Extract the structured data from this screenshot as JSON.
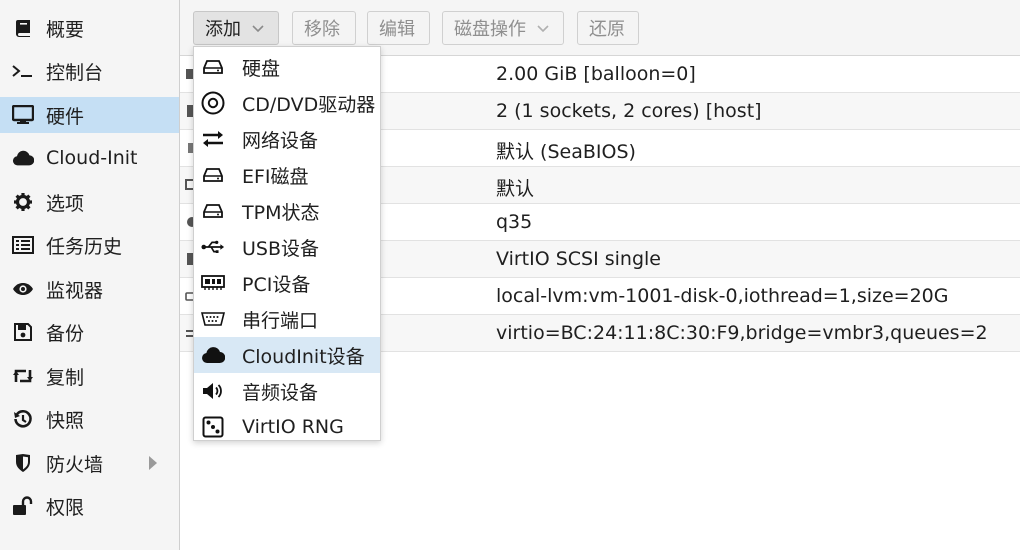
{
  "sidebar": {
    "items": [
      {
        "label": "概要",
        "icon": "book-icon",
        "active": false
      },
      {
        "label": "控制台",
        "icon": "terminal-icon",
        "active": false
      },
      {
        "label": "硬件",
        "icon": "monitor-icon",
        "active": true
      },
      {
        "label": "Cloud-Init",
        "icon": "cloud-icon",
        "active": false
      },
      {
        "label": "选项",
        "icon": "gear-icon",
        "active": false
      },
      {
        "label": "任务历史",
        "icon": "list-icon",
        "active": false
      },
      {
        "label": "监视器",
        "icon": "eye-icon",
        "active": false
      },
      {
        "label": "备份",
        "icon": "floppy-icon",
        "active": false
      },
      {
        "label": "复制",
        "icon": "retweet-icon",
        "active": false
      },
      {
        "label": "快照",
        "icon": "history-icon",
        "active": false
      },
      {
        "label": "防火墙",
        "icon": "shield-icon",
        "active": false,
        "has_submenu": true
      },
      {
        "label": "权限",
        "icon": "unlock-icon",
        "active": false
      }
    ]
  },
  "toolbar": {
    "add_label": "添加",
    "remove_label": "移除",
    "edit_label": "编辑",
    "disk_ops_label": "磁盘操作",
    "revert_label": "还原"
  },
  "grid": {
    "values": [
      "2.00 GiB [balloon=0]",
      "2 (1 sockets, 2 cores) [host]",
      "默认 (SeaBIOS)",
      "默认",
      "q35",
      "VirtIO SCSI single",
      "local-lvm:vm-1001-disk-0,iothread=1,size=20G",
      "virtio=BC:24:11:8C:30:F9,bridge=vmbr3,queues=2"
    ]
  },
  "add_menu": {
    "items": [
      {
        "label": "硬盘",
        "icon": "hdd-icon"
      },
      {
        "label": "CD/DVD驱动器",
        "icon": "disc-icon"
      },
      {
        "label": "网络设备",
        "icon": "exchange-icon"
      },
      {
        "label": "EFI磁盘",
        "icon": "hdd-icon"
      },
      {
        "label": "TPM状态",
        "icon": "hdd-icon"
      },
      {
        "label": "USB设备",
        "icon": "usb-icon"
      },
      {
        "label": "PCI设备",
        "icon": "pci-card-icon"
      },
      {
        "label": "串行端口",
        "icon": "serial-port-icon"
      },
      {
        "label": "CloudInit设备",
        "icon": "cloud-icon",
        "hovered": true
      },
      {
        "label": "音频设备",
        "icon": "volume-icon"
      },
      {
        "label": "VirtIO RNG",
        "icon": "dice-icon"
      }
    ]
  },
  "colors": {
    "active_nav": "#c5dff4",
    "menu_hover": "#d8e8f5",
    "sidebar_bg": "#f5f5f5"
  }
}
